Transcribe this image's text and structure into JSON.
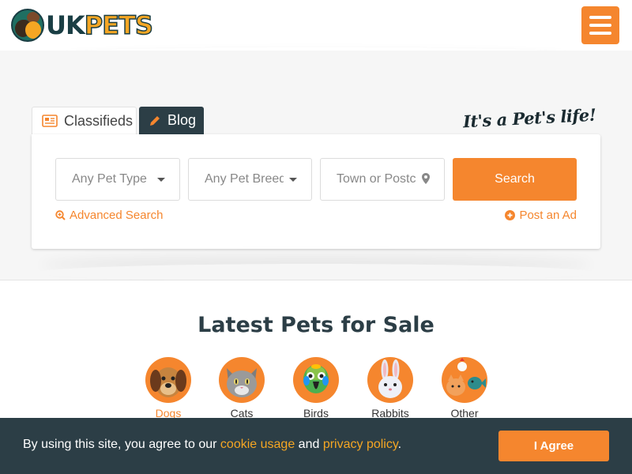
{
  "header": {
    "logo_uk": "UK",
    "logo_pets": "PETS",
    "menu_icon": "hamburger-menu-icon"
  },
  "colors": {
    "accent": "#f5862e",
    "dark": "#2c3e46",
    "link_yellow": "#f5a623"
  },
  "search": {
    "tabs": [
      {
        "label": "Classifieds",
        "icon": "newspaper-icon",
        "active": true
      },
      {
        "label": "Blog",
        "icon": "pencil-icon",
        "active": false
      }
    ],
    "tagline": "It's a Pet's life!",
    "pet_type_placeholder": "Any Pet Type",
    "pet_breed_placeholder": "Any Pet Breed",
    "town_placeholder": "Town or Postcode",
    "search_label": "Search",
    "advanced_search_label": "Advanced Search",
    "post_ad_label": "Post an Ad"
  },
  "latest": {
    "title": "Latest Pets for Sale",
    "categories": [
      {
        "label": "Dogs",
        "icon": "dog-icon",
        "active": true
      },
      {
        "label": "Cats",
        "icon": "cat-icon",
        "active": false
      },
      {
        "label": "Birds",
        "icon": "bird-icon",
        "active": false
      },
      {
        "label": "Rabbits",
        "icon": "rabbit-icon",
        "active": false
      },
      {
        "label": "Other",
        "icon": "other-pets-icon",
        "active": false
      }
    ]
  },
  "cookie": {
    "text_before": "By using this site, you agree to our ",
    "link1": "cookie usage",
    "text_middle": " and ",
    "link2": "privacy policy",
    "text_after": ".",
    "agree_label": "I Agree"
  }
}
